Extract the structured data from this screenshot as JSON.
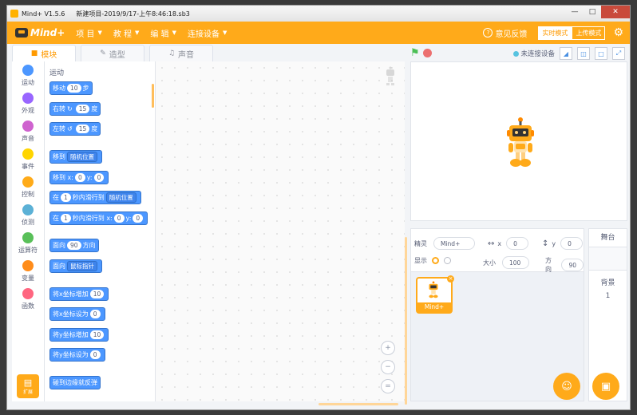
{
  "window": {
    "app_title": "Mind+ V1.5.6",
    "project_title": "新建项目-2019/9/17-上午8:46:18.sb3"
  },
  "menubar": {
    "logo_text": "Mind+",
    "menus": [
      "项 目",
      "教 程",
      "编 辑",
      "连接设备"
    ],
    "feedback": "意见反馈",
    "mode_live": "实时模式",
    "mode_upload": "上传模式"
  },
  "tabs": {
    "code": "模块",
    "costumes": "造型",
    "sounds": "声音"
  },
  "toolbar": {
    "connect_status": "未连接设备"
  },
  "categories": [
    {
      "label": "运动",
      "color": "#4c97ff"
    },
    {
      "label": "外观",
      "color": "#9966ff"
    },
    {
      "label": "声音",
      "color": "#cf63cf"
    },
    {
      "label": "事件",
      "color": "#ffd500"
    },
    {
      "label": "控制",
      "color": "#ffab19"
    },
    {
      "label": "侦测",
      "color": "#5cb1d6"
    },
    {
      "label": "运算符",
      "color": "#59c059"
    },
    {
      "label": "变量",
      "color": "#ff8c1a"
    },
    {
      "label": "函数",
      "color": "#ff6680"
    }
  ],
  "extension_label": "扩展",
  "palette": {
    "header": "运动",
    "move": {
      "a": "移动",
      "n": "10",
      "b": "步"
    },
    "turn_right": {
      "a": "右转",
      "n": "15",
      "b": "度"
    },
    "turn_left": {
      "a": "左转",
      "n": "15",
      "b": "度"
    },
    "goto": {
      "a": "移到",
      "dd": "随机位置"
    },
    "goto_xy": {
      "a": "移到 x:",
      "x": "0",
      "b": "y:",
      "y": "0"
    },
    "glide": {
      "a": "在",
      "n": "1",
      "b": "秒内滑行到",
      "dd": "随机位置"
    },
    "glide_xy": {
      "a": "在",
      "n": "1",
      "b": "秒内滑行到 x:",
      "x": "0",
      "c": "y:",
      "y": "0"
    },
    "point_dir": {
      "a": "面向",
      "n": "90",
      "b": "方向"
    },
    "point_to": {
      "a": "面向",
      "dd": "鼠标指针"
    },
    "change_x": {
      "a": "将x坐标增加",
      "n": "10"
    },
    "set_x": {
      "a": "将x坐标设为",
      "n": "0"
    },
    "change_y": {
      "a": "将y坐标增加",
      "n": "10"
    },
    "set_y": {
      "a": "将y坐标设为",
      "n": "0"
    },
    "bounce": {
      "a": "碰到边缘就反弹"
    }
  },
  "sprite_info": {
    "sprite_label": "精灵",
    "sprite_name": "Mind+",
    "x_label": "x",
    "x": "0",
    "y_label": "y",
    "y": "0",
    "show_label": "显示",
    "size_label": "大小",
    "size": "100",
    "direction_label": "方向",
    "direction": "90"
  },
  "sprite_list": [
    {
      "name": "Mind+"
    }
  ],
  "stage_panel": {
    "header": "舞台",
    "backdrop_label": "背景",
    "backdrop_count": "1"
  }
}
